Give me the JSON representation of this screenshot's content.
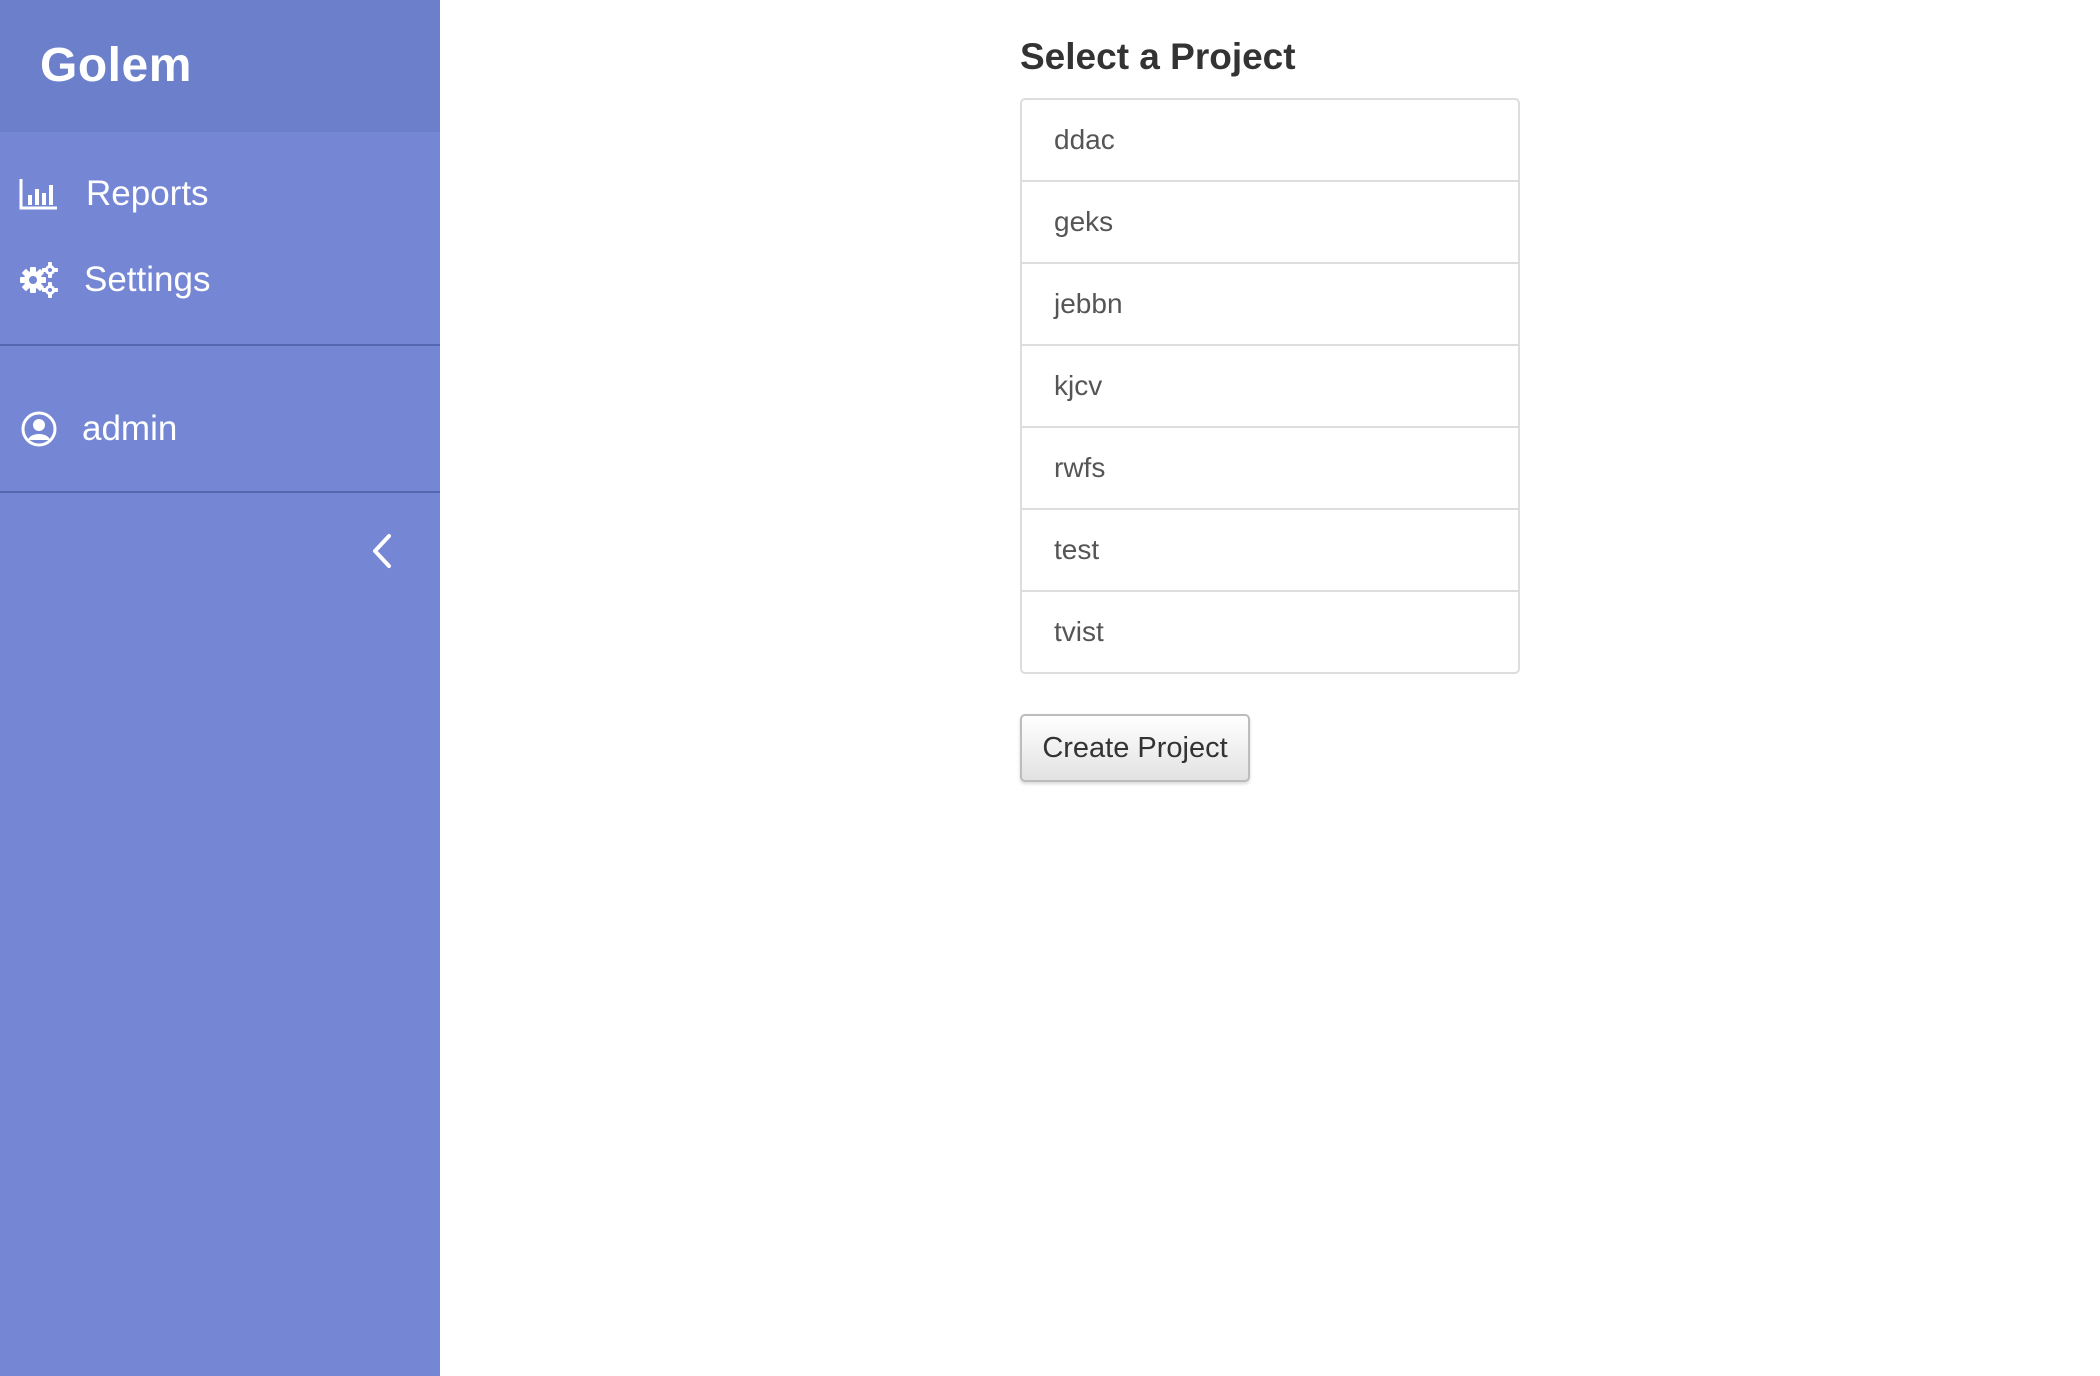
{
  "app": {
    "title": "Golem"
  },
  "sidebar": {
    "nav": [
      {
        "label": "Reports",
        "icon": "bar-chart-icon"
      },
      {
        "label": "Settings",
        "icon": "gears-icon"
      }
    ],
    "user": {
      "label": "admin",
      "icon": "user-circle-icon"
    },
    "collapse_icon": "chevron-left-icon",
    "colors": {
      "background": "#7587d4",
      "header": "#6c7fca",
      "divider": "#5567b0"
    }
  },
  "main": {
    "title": "Select a Project",
    "projects": [
      "ddac",
      "geks",
      "jebbn",
      "kjcv",
      "rwfs",
      "test",
      "tvist"
    ],
    "create_button_label": "Create Project"
  }
}
